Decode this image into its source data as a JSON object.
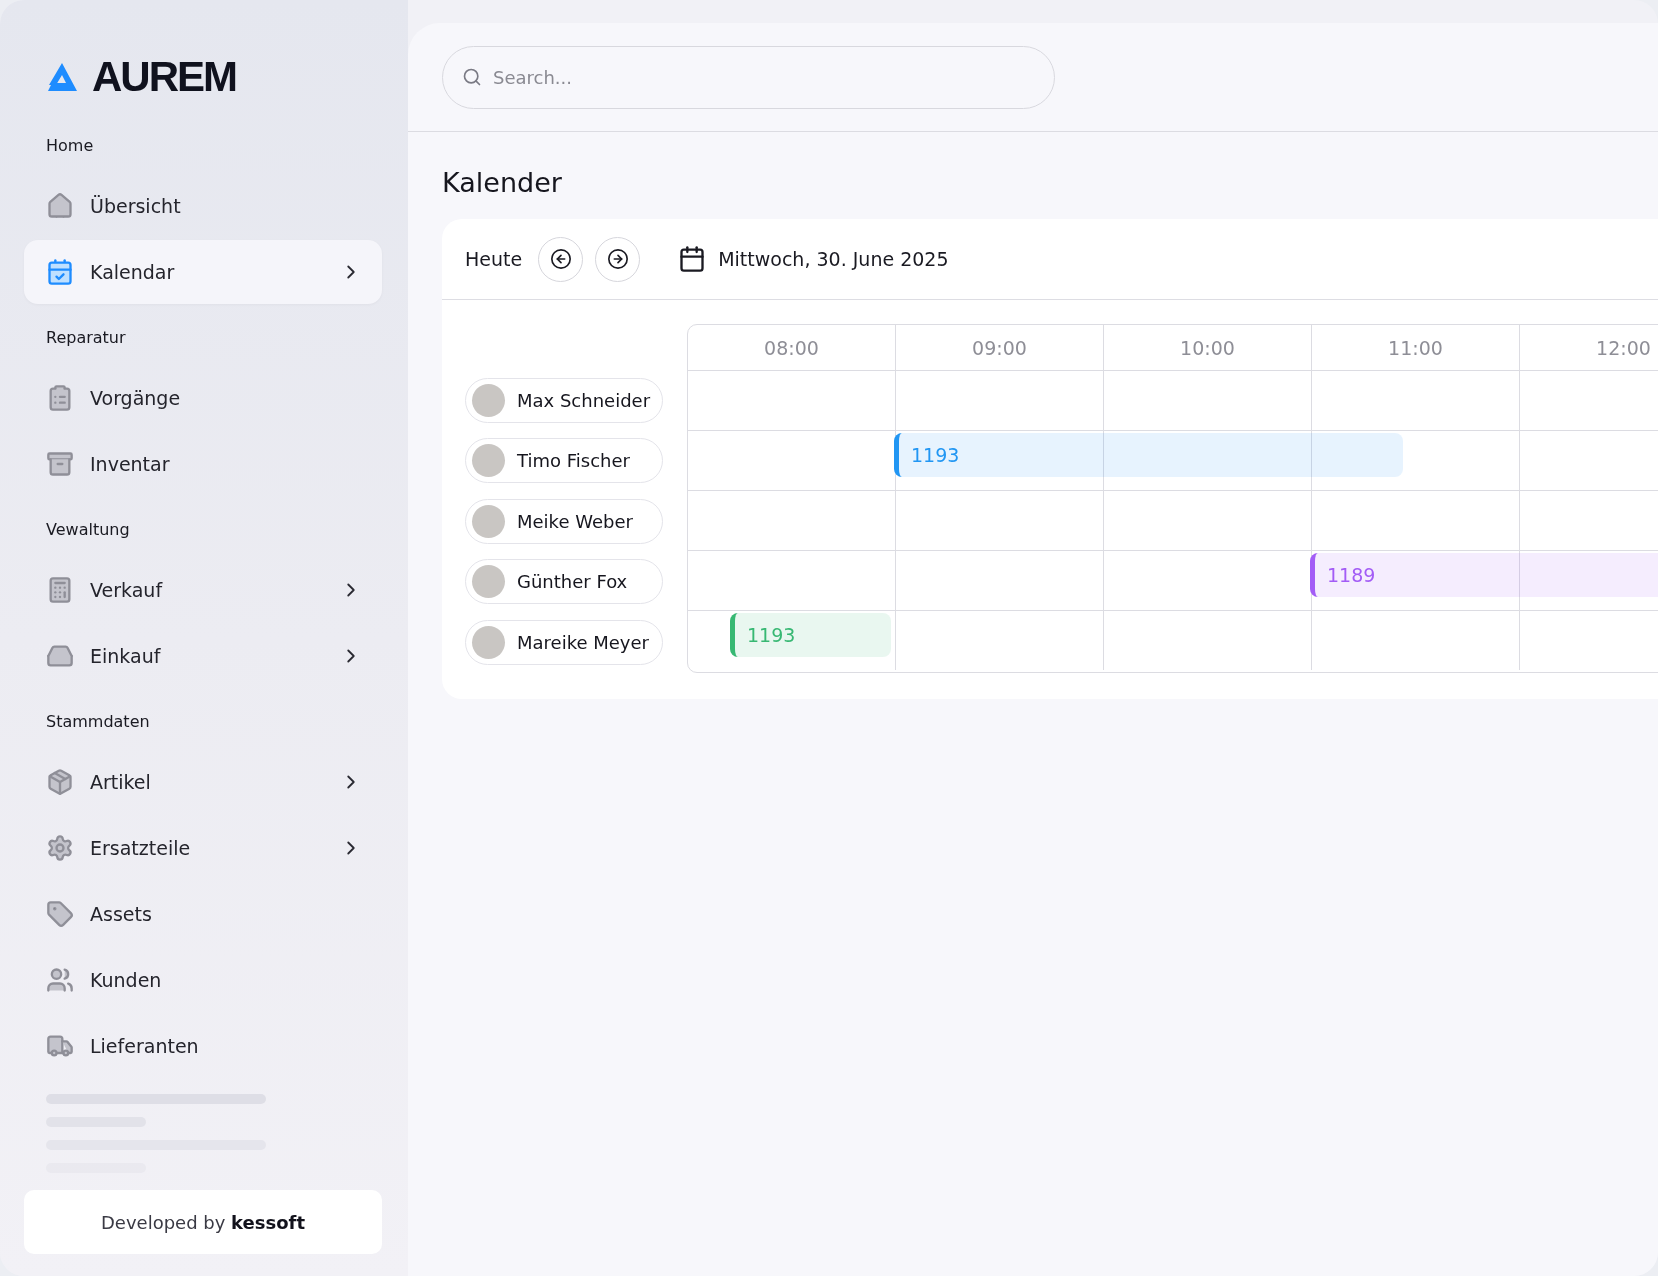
{
  "logo": {
    "text": "AUREM"
  },
  "sidebar": {
    "sections": [
      {
        "title": "Home",
        "items": [
          {
            "label": "Übersicht",
            "selected": false,
            "has_submenu": false
          },
          {
            "label": "Kalendar",
            "selected": true,
            "has_submenu": true
          }
        ]
      },
      {
        "title": "Reparatur",
        "items": [
          {
            "label": "Vorgänge",
            "selected": false,
            "has_submenu": false
          },
          {
            "label": "Inventar",
            "selected": false,
            "has_submenu": false
          }
        ]
      },
      {
        "title": "Vewaltung",
        "items": [
          {
            "label": "Verkauf",
            "selected": false,
            "has_submenu": true
          },
          {
            "label": "Einkauf",
            "selected": false,
            "has_submenu": true
          }
        ]
      },
      {
        "title": "Stammdaten",
        "items": [
          {
            "label": "Artikel",
            "selected": false,
            "has_submenu": true
          },
          {
            "label": "Ersatzteile",
            "selected": false,
            "has_submenu": true
          },
          {
            "label": "Assets",
            "selected": false,
            "has_submenu": false
          },
          {
            "label": "Kunden",
            "selected": false,
            "has_submenu": false
          },
          {
            "label": "Lieferanten",
            "selected": false,
            "has_submenu": false
          }
        ]
      }
    ],
    "footer": "Developed by **kessoft**"
  },
  "search": {
    "placeholder": "Search..."
  },
  "page_title": "Kalender",
  "calendar": {
    "today_button": "Heute",
    "date": "Mittwoch, 30. June 2025",
    "hours": [
      "08:00",
      "09:00",
      "10:00",
      "11:00",
      "12:00"
    ],
    "rows": [
      {
        "name": "Max Schneider",
        "events": []
      },
      {
        "name": "Timo Fischer",
        "events": [
          {
            "label": "1193",
            "color": "#2196f3"
          }
        ]
      },
      {
        "name": "Meike Weber",
        "events": []
      },
      {
        "name": "Günther Fox",
        "events": [
          {
            "label": "1189",
            "color": "#a35cf6"
          }
        ]
      },
      {
        "name": "Mareike Meyer",
        "events": [
          {
            "label": "1193",
            "color": "#37b873"
          }
        ]
      }
    ]
  }
}
